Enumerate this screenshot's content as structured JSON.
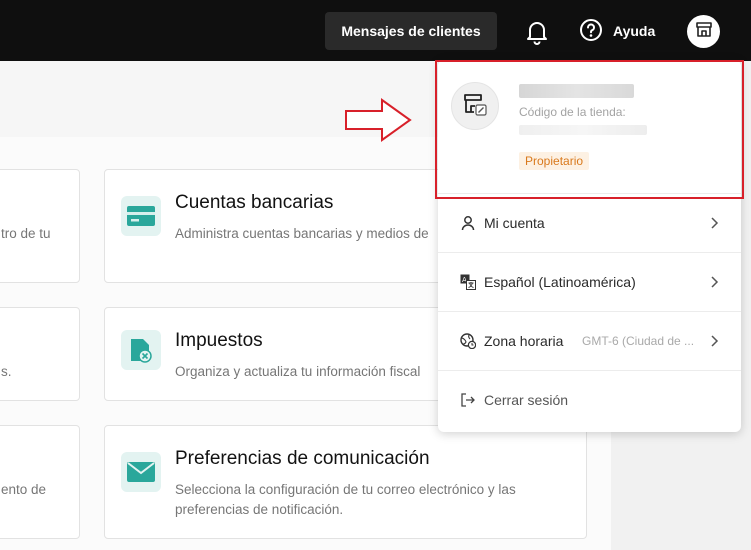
{
  "topbar": {
    "messages_button": "Mensajes de clientes",
    "help_label": "Ayuda",
    "bell_icon": "bell-icon",
    "help_icon": "question-circle-icon",
    "store_icon": "storefront-icon"
  },
  "cards": {
    "left": [
      {
        "desc": "tro de tu"
      },
      {
        "desc": "s."
      },
      {
        "desc": "ento de"
      }
    ],
    "right": [
      {
        "title": "Cuentas bancarias",
        "desc": "Administra cuentas bancarias y medios de",
        "icon": "bank-card-icon"
      },
      {
        "title": "Impuestos",
        "desc": "Organiza y actualiza tu información fiscal",
        "icon": "tax-document-icon"
      },
      {
        "title": "Preferencias de comunicación",
        "desc": "Selecciona la configuración de tu correo electrónico y las preferencias de notificación.",
        "icon": "envelope-icon"
      }
    ]
  },
  "dropdown": {
    "store_code_label": "Código de la tienda:",
    "role_badge": "Propietario",
    "items": [
      {
        "label": "Mi cuenta",
        "icon": "person-icon",
        "extra": ""
      },
      {
        "label": "Español (Latinoamérica)",
        "icon": "translate-icon",
        "extra": ""
      },
      {
        "label": "Zona horaria",
        "icon": "globe-clock-icon",
        "extra": "GMT-6 (Ciudad de ..."
      },
      {
        "label": "Cerrar sesión",
        "icon": "logout-icon",
        "extra": ""
      }
    ]
  },
  "colors": {
    "accent_teal": "#2aa79b",
    "highlight_red": "#d8202a",
    "badge_orange": "#d9791c"
  }
}
